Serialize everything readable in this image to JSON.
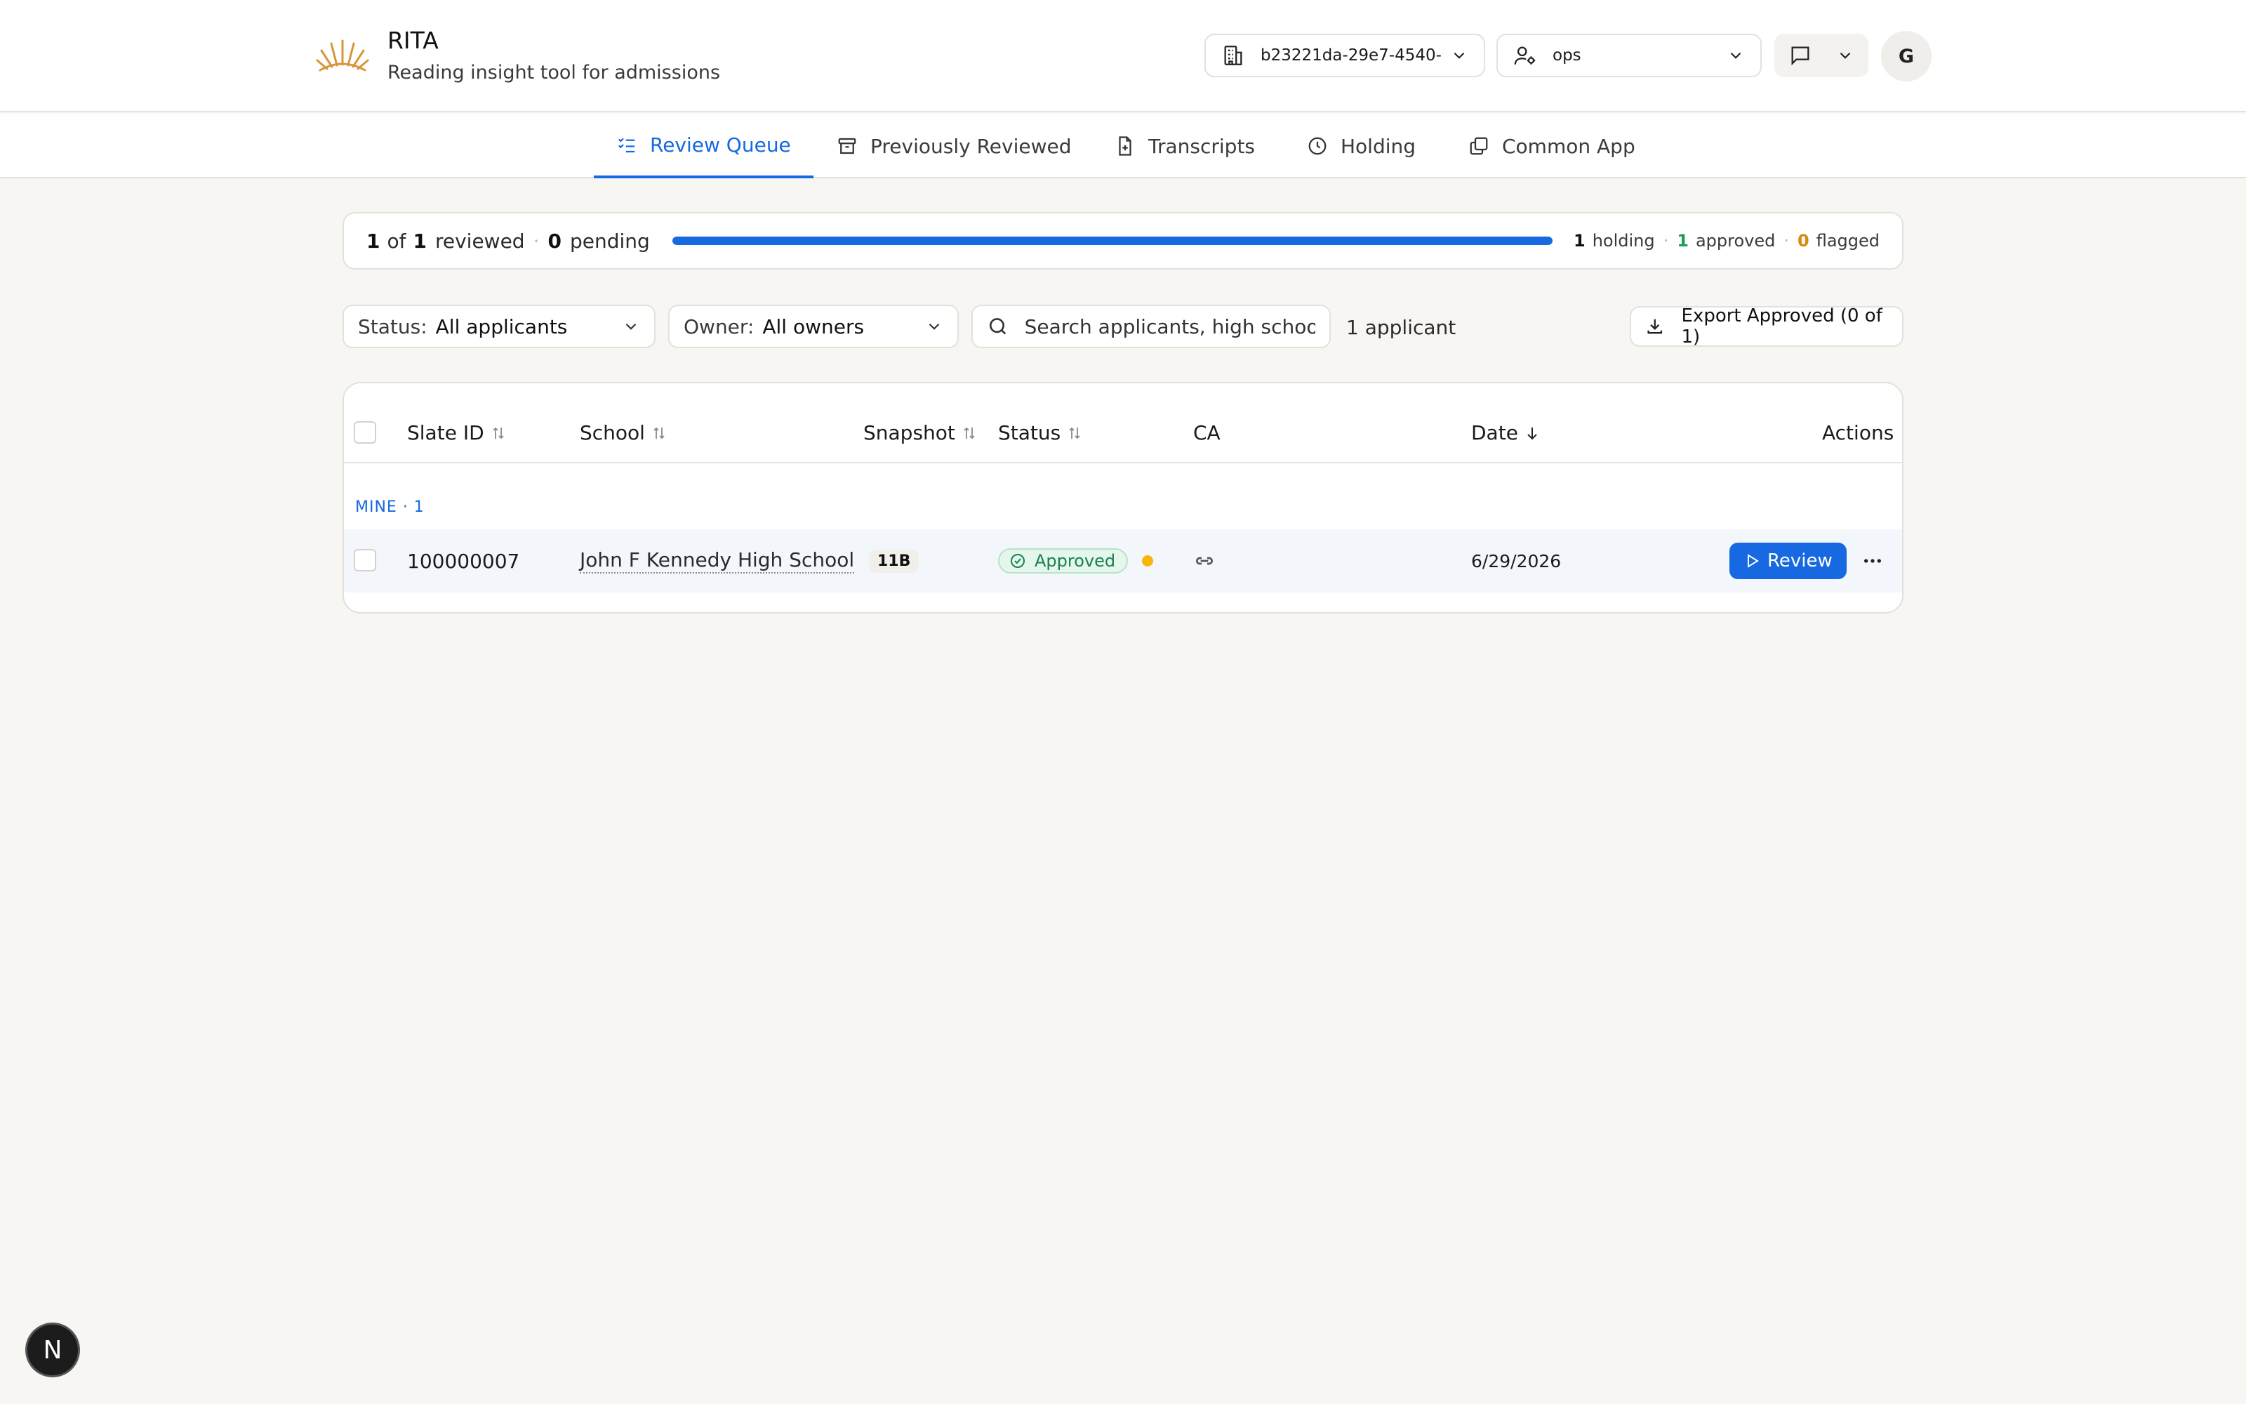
{
  "app": {
    "title": "RITA",
    "subtitle": "Reading insight tool for admissions"
  },
  "header": {
    "org_selector": "b23221da-29e7-4540-",
    "role_selector": "ops",
    "avatar_initial": "G"
  },
  "tabs": [
    {
      "label": "Review Queue",
      "icon": "checklist-icon",
      "active": true
    },
    {
      "label": "Previously Reviewed",
      "icon": "archive-icon",
      "active": false
    },
    {
      "label": "Transcripts",
      "icon": "file-plus-icon",
      "active": false
    },
    {
      "label": "Holding",
      "icon": "clock-icon",
      "active": false
    },
    {
      "label": "Common App",
      "icon": "copy-icon",
      "active": false
    }
  ],
  "progress": {
    "reviewed": "1",
    "of_word": "of",
    "total": "1",
    "reviewed_word": "reviewed",
    "pending": "0",
    "pending_word": "pending",
    "fraction": 1.0,
    "holding": "1",
    "holding_word": "holding",
    "approved": "1",
    "approved_word": "approved",
    "flagged": "0",
    "flagged_word": "flagged"
  },
  "filters": {
    "status_label": "Status:",
    "status_value": "All applicants",
    "owner_label": "Owner:",
    "owner_value": "All owners",
    "search_placeholder": "Search applicants, high schools",
    "count_label": "1 applicant",
    "export_label": "Export Approved (0 of 1)"
  },
  "table": {
    "columns": {
      "slate_id": "Slate ID",
      "school": "School",
      "snapshot": "Snapshot",
      "status": "Status",
      "ca": "CA",
      "date": "Date",
      "actions": "Actions"
    },
    "group_label": "MINE · 1",
    "rows": [
      {
        "slate_id": "100000007",
        "school": "John F Kennedy High School",
        "snapshot": "11B",
        "status": "Approved",
        "date": "6/29/2026",
        "action_label": "Review"
      }
    ]
  },
  "colors": {
    "accent": "#1669e0",
    "approved": "#17824e",
    "flagged": "#d98a0c",
    "warning_dot": "#f5b70a"
  },
  "dev_badge": "N"
}
